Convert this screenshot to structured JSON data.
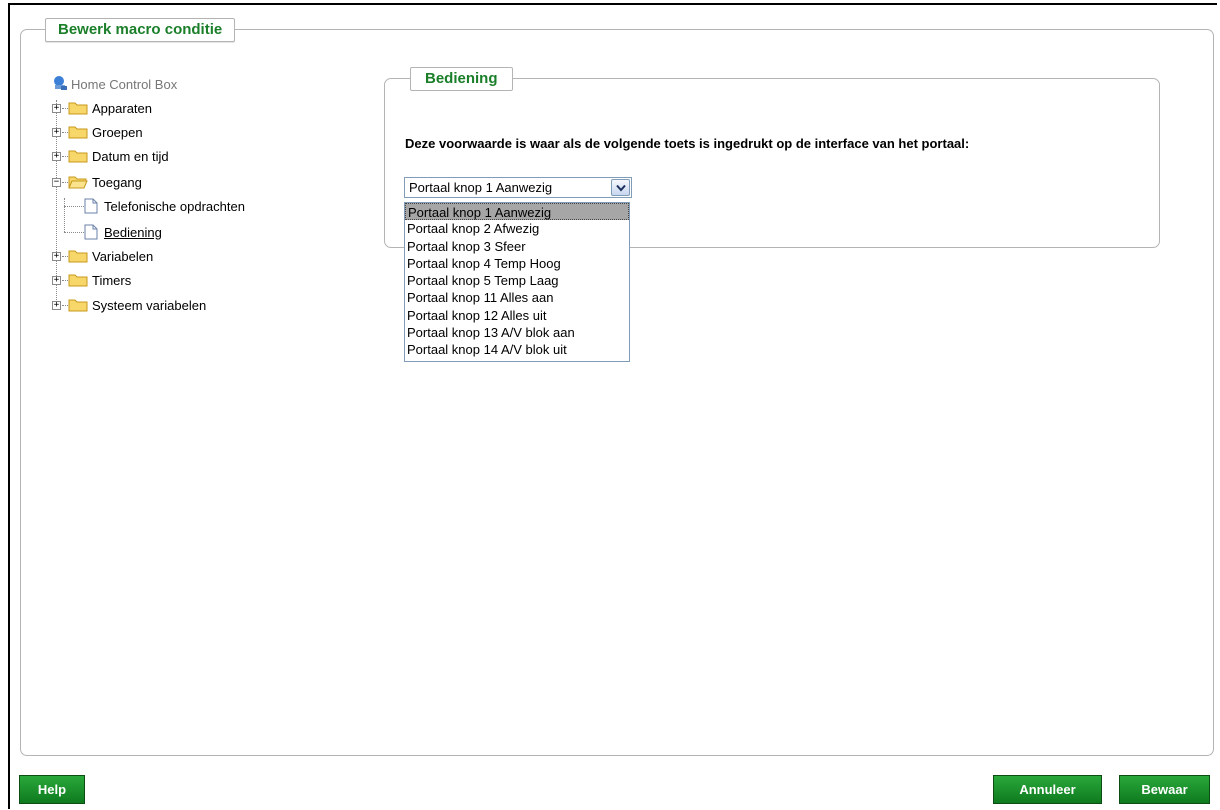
{
  "dialog": {
    "title": "Bewerk macro conditie"
  },
  "tree": {
    "root": "Home Control Box",
    "items": [
      {
        "label": "Apparaten",
        "expander": "+"
      },
      {
        "label": "Groepen",
        "expander": "+"
      },
      {
        "label": "Datum en tijd",
        "expander": "+"
      },
      {
        "label": "Toegang",
        "expander": "−",
        "children": [
          {
            "label": "Telefonische opdrachten"
          },
          {
            "label": "Bediening"
          }
        ]
      },
      {
        "label": "Variabelen",
        "expander": "+"
      },
      {
        "label": "Timers",
        "expander": "+"
      },
      {
        "label": "Systeem variabelen",
        "expander": "+"
      }
    ]
  },
  "panel": {
    "title": "Bediening",
    "question": "Deze voorwaarde is waar als de volgende toets is ingedrukt op de interface van het portaal:",
    "select": {
      "value": "Portaal knop 1 Aanwezig",
      "options": [
        "Portaal knop 1 Aanwezig",
        "Portaal knop 2 Afwezig",
        "Portaal knop 3 Sfeer",
        "Portaal knop 4 Temp Hoog",
        "Portaal knop 5 Temp Laag",
        "Portaal knop 11 Alles aan",
        "Portaal knop 12 Alles uit",
        "Portaal knop 13 A/V blok aan",
        "Portaal knop 14 A/V blok uit"
      ]
    }
  },
  "buttons": {
    "help": "Help",
    "cancel": "Annuleer",
    "save": "Bewaar"
  },
  "colors": {
    "accent": "#1b7f2a",
    "button": "#138a25"
  }
}
